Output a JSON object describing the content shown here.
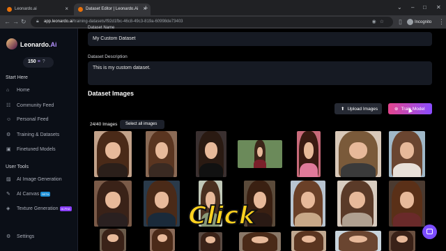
{
  "browser": {
    "tabs": [
      {
        "label": "Leonardo.ai",
        "active": false
      },
      {
        "label": "Dataset Editor | Leonardo.Ai",
        "active": true
      }
    ],
    "url_host": "app.leonardo.ai",
    "url_path": "/training-datasets/f92d1fbc-46c8-49c3-819a-60998de73403",
    "profile_label": "Incognito"
  },
  "sidebar": {
    "brand": "Leonardo.",
    "brand_accent": "Ai",
    "tokens": "150",
    "start_here": "Start Here",
    "items": [
      {
        "label": "Home",
        "icon": "home-icon"
      },
      {
        "label": "Community Feed",
        "icon": "community-icon"
      },
      {
        "label": "Personal Feed",
        "icon": "personal-icon"
      },
      {
        "label": "Training & Datasets",
        "icon": "training-icon"
      },
      {
        "label": "Finetuned Models",
        "icon": "models-icon"
      }
    ],
    "user_tools": "User Tools",
    "tools": [
      {
        "label": "AI Image Generation",
        "icon": "image-gen-icon",
        "badge": ""
      },
      {
        "label": "AI Canvas",
        "icon": "canvas-icon",
        "badge": "BETA"
      },
      {
        "label": "Texture Generation",
        "icon": "texture-icon",
        "badge": "ALPHA"
      }
    ],
    "settings": "Settings"
  },
  "main": {
    "dataset_name_label": "Dataset Name",
    "dataset_name_value": "My Custom Dataset",
    "description_label": "Dataset Description",
    "description_value": "This is my custom dataset.",
    "images_heading": "Dataset Images",
    "upload_label": "Upload Images",
    "train_label": "Train Model",
    "image_count": "24/40 Images",
    "select_all_label": "Select all images"
  },
  "overlay": {
    "click_caption": "Click"
  },
  "colors": {
    "accent_purple": "#8a4dff",
    "accent_pink": "#e4458d",
    "sidebar_bg": "#0b0f17",
    "field_bg": "#161a23",
    "caption_yellow": "#ffd21f"
  }
}
